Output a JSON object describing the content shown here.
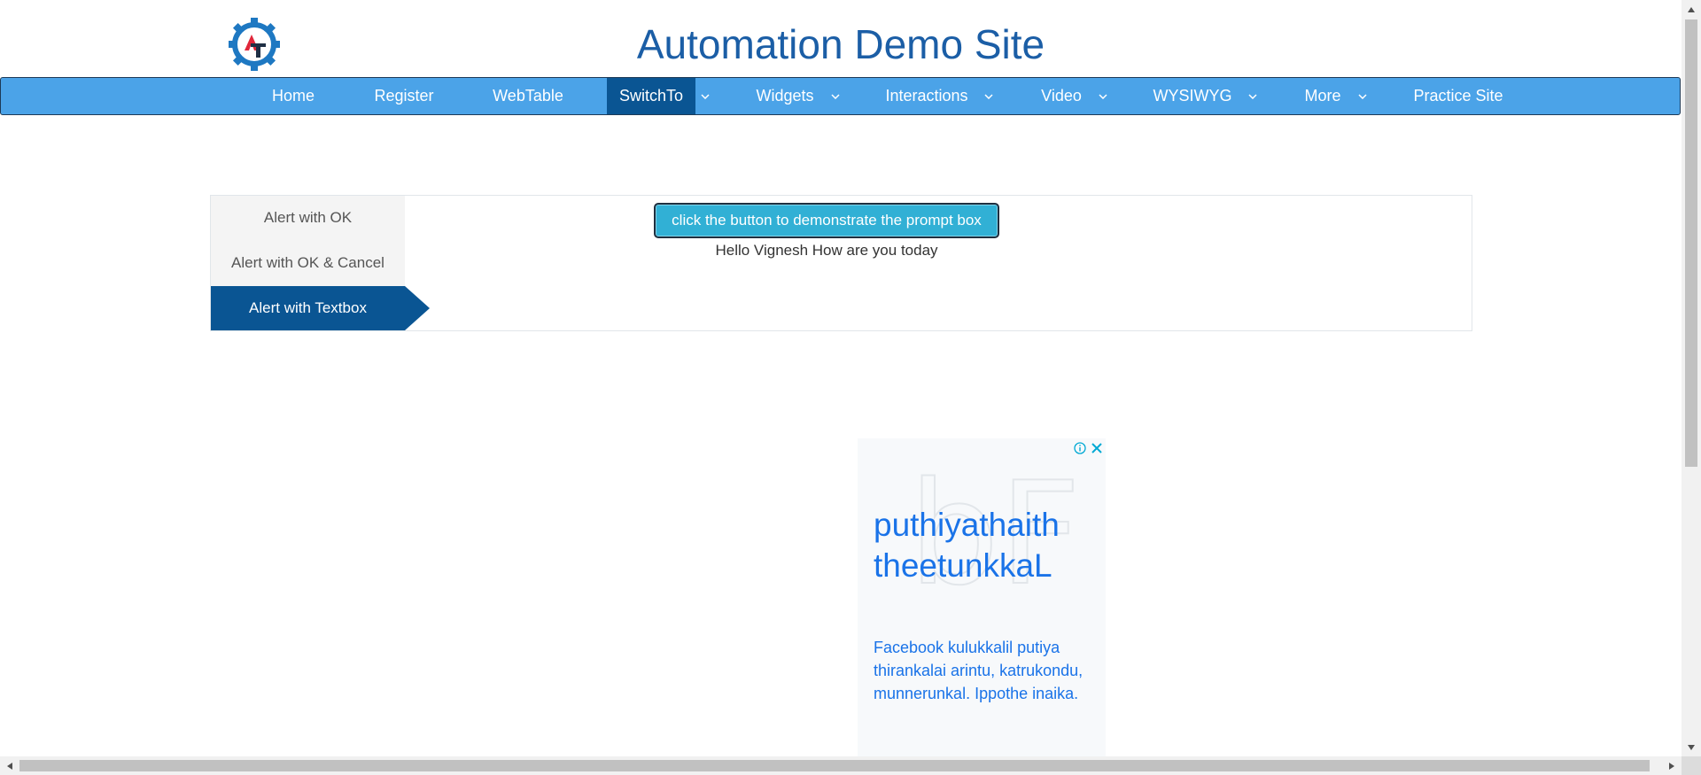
{
  "site": {
    "title": "Automation Demo Site"
  },
  "nav": {
    "items": [
      {
        "label": "Home"
      },
      {
        "label": "Register"
      },
      {
        "label": "WebTable"
      },
      {
        "label": "SwitchTo"
      },
      {
        "label": "Widgets"
      },
      {
        "label": "Interactions"
      },
      {
        "label": "Video"
      },
      {
        "label": "WYSIWYG"
      },
      {
        "label": "More"
      },
      {
        "label": "Practice Site"
      }
    ]
  },
  "tabs": {
    "items": [
      {
        "label": "Alert with OK"
      },
      {
        "label": "Alert with OK & Cancel"
      },
      {
        "label": "Alert with Textbox"
      }
    ],
    "active": "Alert with Textbox"
  },
  "alert_panel": {
    "button_label": "click the button to demonstrate the prompt box",
    "result_text": "Hello Vignesh How are you today"
  },
  "ad": {
    "headline": "puthiyathaith theetunkkaL",
    "body": "Facebook kulukkalil putiya thirankalai arintu, katrukondu, munnerunkal. Ippothe inaika.",
    "info_icon": "info-icon",
    "close_icon": "close-icon"
  },
  "colors": {
    "nav_bg": "#4ba3e8",
    "nav_active": "#0a5593",
    "title": "#1b5ea6",
    "button": "#31b0d5",
    "ad_text": "#1a73e8"
  }
}
